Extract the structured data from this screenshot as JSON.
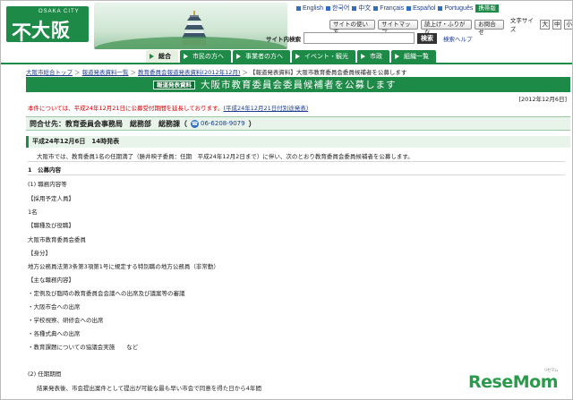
{
  "header": {
    "logo": {
      "city": "OSAKA CITY",
      "mark": "不",
      "name": "大阪市"
    },
    "languages": [
      "English",
      "한국어",
      "中文",
      "Français",
      "Español",
      "Português"
    ],
    "mobile": "携帯版",
    "util_buttons": [
      "サイトの使い方",
      "サイトマップ",
      "読上げ・ふりがな",
      "お問合せ"
    ],
    "text_size_label": "文字サイズ",
    "text_sizes": [
      "大",
      "中",
      "小"
    ],
    "search_label": "サイト内検索",
    "search_button": "検索",
    "search_help": "検索ヘルプ"
  },
  "nav": {
    "tabs": [
      "総合",
      "市民の方へ",
      "事業者の方へ",
      "イベント・観光",
      "市政",
      "組織一覧"
    ],
    "active_index": 0
  },
  "breadcrumb": [
    "大阪市総合トップ",
    "報道発表資料一覧",
    "教育委員会報道発表資料(2012年12月)",
    "【報道発表資料】大阪市教育委員会委員候補者を公募します"
  ],
  "page": {
    "badge": "報道発表資料",
    "title": "大阪市教育委員会委員候補者を公募します",
    "date": "[2012年12月6日]",
    "notice_text": "本件については、平成24年12月21日に公募受付期間を延長しております。",
    "notice_link": "(平成24年12月21日付別途発表)",
    "contact_label": "問合せ先：教育委員会事務局　総務部　総務課（",
    "contact_tel": "06-6208-9079",
    "contact_end": "）",
    "pub_date": "平成24年12月6日　14時発表"
  },
  "content": {
    "intro": "大阪市では、教育委員1名の任期満了（勝井映子委員：任期　平成24年12月2日まで）に伴い、次のとおり教育委員会委員候補者を公募します。",
    "section1": "1　公募内容",
    "sub1": "(1) 職務内容等",
    "h_number": "【採用予定人員】",
    "v_number": "1名",
    "h_title": "【職種及び役職】",
    "v_title": "大阪市教育委員会委員",
    "h_status": "【身分】",
    "v_status": "地方公務員法第3条第3項第1号に規定する特別職の地方公務員（非常勤）",
    "h_duties": "【主な職務内容】",
    "duties": [
      "・定例及び臨時の教育委員会会議への出席及び議案等の審議",
      "・大阪市会への出席",
      "・学校視察、研修会への出席",
      "・各種式典への出席",
      "・教育課題についての協議会実施　　など"
    ],
    "sub2": "(2) 任期期間",
    "v_term": "結果発表後、市会提出案件として提出が可能な最も早い市会で同意を得た日から4年間"
  },
  "watermark": {
    "brand": "ReseMom",
    "kana": "リセマム"
  }
}
